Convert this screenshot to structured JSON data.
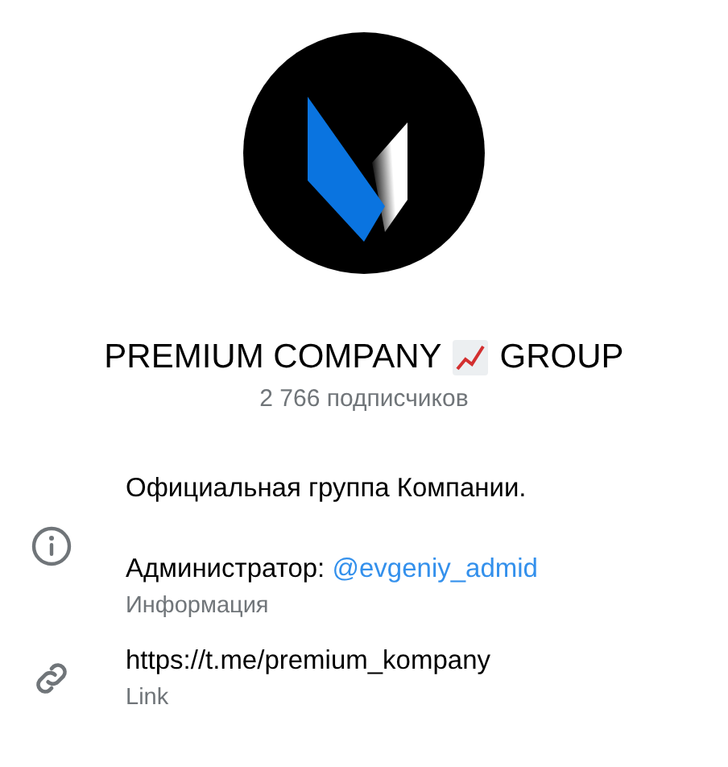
{
  "profile": {
    "title_before_emoji": "PREMIUM COMPANY",
    "title_after_emoji": "GROUP",
    "subscribers": "2 766 подписчиков"
  },
  "info_rows": [
    {
      "kind": "info",
      "paragraphs": [
        {
          "text": "Официальная группа Компании."
        },
        {
          "text": "Администратор:",
          "link": "@evgeniy_admid"
        }
      ],
      "label": "Информация"
    },
    {
      "kind": "link",
      "paragraphs": [
        {
          "text": "https://t.me/premium_kompany"
        }
      ],
      "label": "Link"
    }
  ]
}
